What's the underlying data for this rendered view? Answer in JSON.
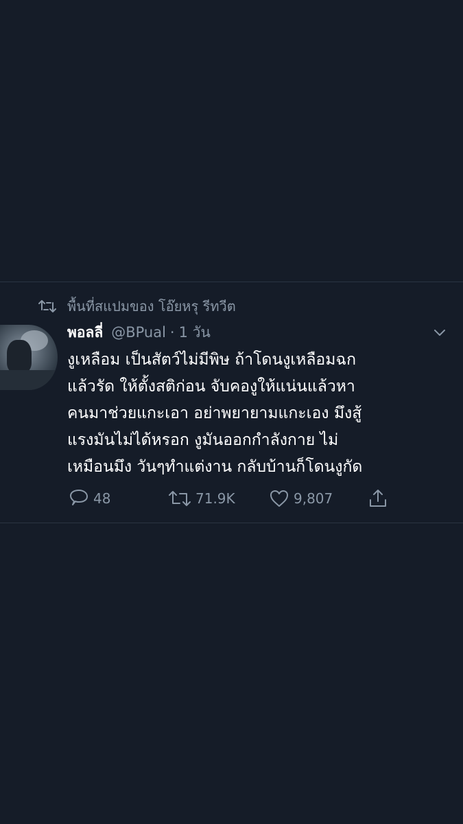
{
  "retweet_context": {
    "text": "พื้นที่สแปมของ โอ๊ยหรุ รีทวีต",
    "icon": "retweet-icon"
  },
  "author": {
    "name": "พอลลี่",
    "handle": "@BPual",
    "separator": "·",
    "time": "1 วัน",
    "avatar": "avatar-image"
  },
  "tweet": {
    "lines": [
      "งูเหลือม เป็นสัตว์ไม่มีพิษ ถ้าโดนงูเหลือมฉก",
      "แล้วรัด ให้ตั้งสติก่อน จับคองูให้แน่นแล้วหา",
      "คนมาช่วยแกะเอา อย่าพยายามแกะเอง มึงสู้",
      "แรงมันไม่ได้หรอก งูมันออกกำลังกาย ไม่",
      "เหมือนมึง วันๆทำแต่งาน กลับบ้านก็โดนงูกัด"
    ]
  },
  "actions": {
    "replies": "48",
    "retweets": "71.9K",
    "likes": "9,807",
    "reply_icon": "reply-icon",
    "retweet_icon": "retweet-icon",
    "like_icon": "heart-icon",
    "share_icon": "share-icon",
    "menu_icon": "chevron-down-icon"
  },
  "colors": {
    "background": "#151c28",
    "secondary_text": "#8a97a6",
    "primary_text": "#ffffff"
  }
}
